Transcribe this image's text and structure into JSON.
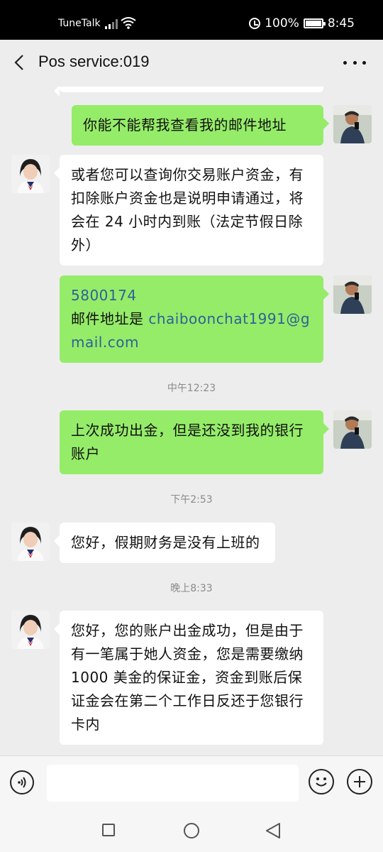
{
  "status_bar": {
    "carrier": "TuneTalk",
    "battery": "100%",
    "time": "8:45",
    "icons": [
      "signal-icon",
      "wifi-icon",
      "alarm-icon",
      "battery-icon"
    ]
  },
  "header": {
    "title": "Pos service:019",
    "back_icon": "chevron-left-icon",
    "more_icon": "more-dots-icon"
  },
  "messages": [
    {
      "from": "me",
      "text": "你能不能帮我查看我的邮件地址"
    },
    {
      "from": "agent",
      "text": "或者您可以查询你交易账户资金，有扣除账户资金也是说明申请通过，将会在 24 小时内到账（法定节假日除外）"
    },
    {
      "from": "me",
      "line1": "5800174",
      "line2_prefix": "邮件地址是 ",
      "email": "chaiboonchat1991@gmail.com"
    },
    {
      "from": "me",
      "text": "上次成功出金，但是还没到我的银行账户"
    },
    {
      "from": "agent",
      "text": "您好，假期财务是没有上班的"
    },
    {
      "from": "agent",
      "text": "您好，您的账户出金成功，但是由于有一笔属于她人资金，您是需要缴纳 1000 美金的保证金，资金到账后保证金会在第二个工作日反还于您银行卡内"
    }
  ],
  "timestamps": [
    "中午12:23",
    "下午2:53",
    "晚上8:33"
  ],
  "input_bar": {
    "value": "",
    "icons": [
      "voice-icon",
      "emoji-icon",
      "plus-icon"
    ]
  },
  "system_nav": {
    "icons": [
      "recent-apps-icon",
      "home-icon",
      "back-icon"
    ]
  },
  "colors": {
    "outgoing_bubble": "#95ec69",
    "incoming_bubble": "#ffffff",
    "background": "#ededed",
    "link": "#2f6295"
  }
}
